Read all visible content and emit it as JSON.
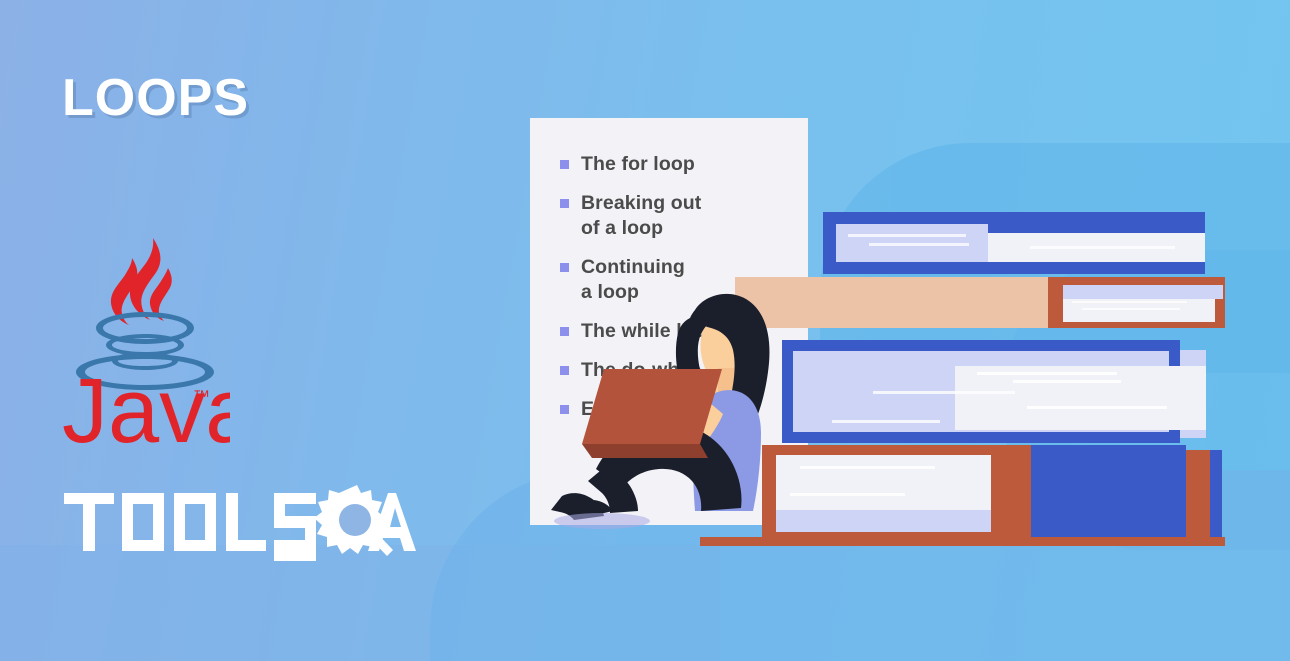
{
  "banner": {
    "title": "LOOPS",
    "brand": {
      "java_wordmark": "Java",
      "java_trademark": "™",
      "toolsqa_part1": "TOOLS",
      "toolsqa_part2": "A",
      "toolsqa_icon": "gear-magnifier-q-icon"
    },
    "colors": {
      "bg_gradient_start": "#8cb1e7",
      "bg_gradient_end": "#72c6f0",
      "panel": "#f2f2f7",
      "bullet": "#8c90ec",
      "list_text": "#4b4b4b",
      "title_text": "#ffffff",
      "book_blue": "#3a5bc7",
      "book_terracotta": "#bd5a3c",
      "book_peach": "#edc3a8",
      "book_page_light": "#f1f1f8",
      "book_page_blue": "#cdd4f5",
      "java_red": "#e0242a",
      "java_blue": "#3a77ab",
      "skin": "#fbcf9c",
      "hair": "#1b1f2b",
      "top_purple": "#8c9ae6",
      "laptop": "#b4533b"
    },
    "list": {
      "items": [
        {
          "label": "The for loop"
        },
        {
          "label": "Breaking out\nof a loop"
        },
        {
          "label": "Continuing\na loop"
        },
        {
          "label": "The while loop"
        },
        {
          "label": "The do-while loop"
        },
        {
          "label": "Enhanced for loop"
        }
      ]
    },
    "illustration": {
      "name": "woman-with-laptop-and-book-stack",
      "elements": [
        "book-stack",
        "seated-woman",
        "laptop"
      ]
    }
  }
}
